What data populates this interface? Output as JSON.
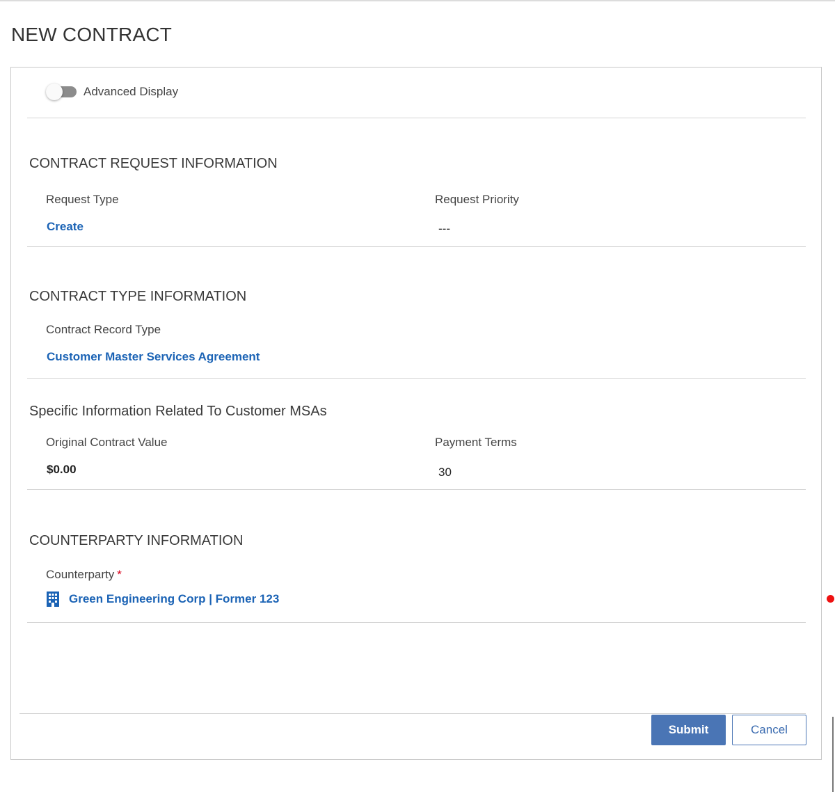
{
  "page": {
    "title": "NEW CONTRACT"
  },
  "advanced_display": {
    "label": "Advanced Display",
    "enabled": false
  },
  "sections": {
    "contract_request": {
      "title": "CONTRACT REQUEST INFORMATION",
      "request_type_label": "Request Type",
      "request_type_value": "Create",
      "request_priority_label": "Request Priority",
      "request_priority_value": "---"
    },
    "contract_type": {
      "title": "CONTRACT TYPE INFORMATION",
      "record_type_label": "Contract Record Type",
      "record_type_value": "Customer Master Services Agreement"
    },
    "customer_msa": {
      "title": "Specific Information Related To Customer MSAs",
      "original_value_label": "Original Contract Value",
      "original_value": "$0.00",
      "payment_terms_label": "Payment Terms",
      "payment_terms_value": "30"
    },
    "counterparty": {
      "title": "COUNTERPARTY INFORMATION",
      "counterparty_label": "Counterparty",
      "required_marker": "*",
      "counterparty_value": "Green Engineering Corp | Former 123",
      "icon": "building-icon"
    }
  },
  "footer": {
    "submit_label": "Submit",
    "cancel_label": "Cancel"
  },
  "colors": {
    "link": "#1b63b5",
    "primary_button": "#4a75b5",
    "required": "#d9001b",
    "indicator_dot": "#ee1111"
  }
}
